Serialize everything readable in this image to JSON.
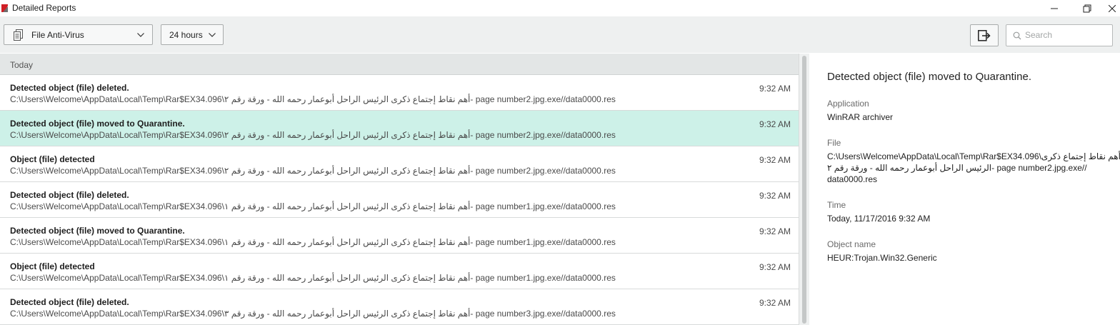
{
  "window": {
    "title": "Detailed Reports"
  },
  "toolbar": {
    "component_dropdown": "File Anti-Virus",
    "period_dropdown": "24 hours",
    "search_placeholder": "Search"
  },
  "list": {
    "group_label": "Today",
    "rows": [
      {
        "title": "Detected object (file) deleted.",
        "path": "C:\\Users\\Welcome\\AppData\\Local\\Temp\\Rar$EX34.096\\أهم نقاط إجتماع ذكرى الرئيس الراحل أبوعمار رحمه الله - ورقة رقم ٢- page number2.jpg.exe//data0000.res",
        "time": "9:32 AM"
      },
      {
        "title": "Detected object (file) moved to Quarantine.",
        "path": "C:\\Users\\Welcome\\AppData\\Local\\Temp\\Rar$EX34.096\\أهم نقاط إجتماع ذكرى الرئيس الراحل أبوعمار رحمه الله - ورقة رقم ٢- page number2.jpg.exe//data0000.res",
        "time": "9:32 AM"
      },
      {
        "title": "Object (file) detected",
        "path": "C:\\Users\\Welcome\\AppData\\Local\\Temp\\Rar$EX34.096\\أهم نقاط إجتماع ذكرى الرئيس الراحل أبوعمار رحمه الله - ورقة رقم ٢- page number2.jpg.exe//data0000.res",
        "time": "9:32 AM"
      },
      {
        "title": "Detected object (file) deleted.",
        "path": "C:\\Users\\Welcome\\AppData\\Local\\Temp\\Rar$EX34.096\\أهم نقاط إجتماع ذكرى الرئيس الراحل أبوعمار رحمه الله - ورقة رقم ١- page number1.jpg.exe//data0000.res",
        "time": "9:32 AM"
      },
      {
        "title": "Detected object (file) moved to Quarantine.",
        "path": "C:\\Users\\Welcome\\AppData\\Local\\Temp\\Rar$EX34.096\\أهم نقاط إجتماع ذكرى الرئيس الراحل أبوعمار رحمه الله - ورقة رقم ١- page number1.jpg.exe//data0000.res",
        "time": "9:32 AM"
      },
      {
        "title": "Object (file) detected",
        "path": "C:\\Users\\Welcome\\AppData\\Local\\Temp\\Rar$EX34.096\\أهم نقاط إجتماع ذكرى الرئيس الراحل أبوعمار رحمه الله - ورقة رقم ١- page number1.jpg.exe//data0000.res",
        "time": "9:32 AM"
      },
      {
        "title": "Detected object (file) deleted.",
        "path": "C:\\Users\\Welcome\\AppData\\Local\\Temp\\Rar$EX34.096\\أهم نقاط إجتماع ذكرى الرئيس الراحل أبوعمار رحمه الله - ورقة رقم ٣- page number3.jpg.exe//data0000.res",
        "time": "9:32 AM"
      }
    ]
  },
  "details": {
    "heading": "Detected object (file) moved to Quarantine.",
    "application_label": "Application",
    "application_value": "WinRAR archiver",
    "file_label": "File",
    "file_lines": [
      "C:\\Users\\Welcome\\AppData\\Local\\Temp\\Rar$EX34.096\\أهم نقاط إجتماع ذكرى",
      "الرئيس الراحل أبوعمار رحمه الله - ورقة رقم ٢- page number2.jpg.exe//",
      "data0000.res"
    ],
    "time_label": "Time",
    "time_value": "Today, 11/17/2016 9:32 AM",
    "object_label": "Object name",
    "object_value": "HEUR:Trojan.Win32.Generic"
  },
  "colors": {
    "selected_row": "#cdf1e8",
    "toolbar_bg": "#eef0f0",
    "brand_red": "#d11f26"
  }
}
